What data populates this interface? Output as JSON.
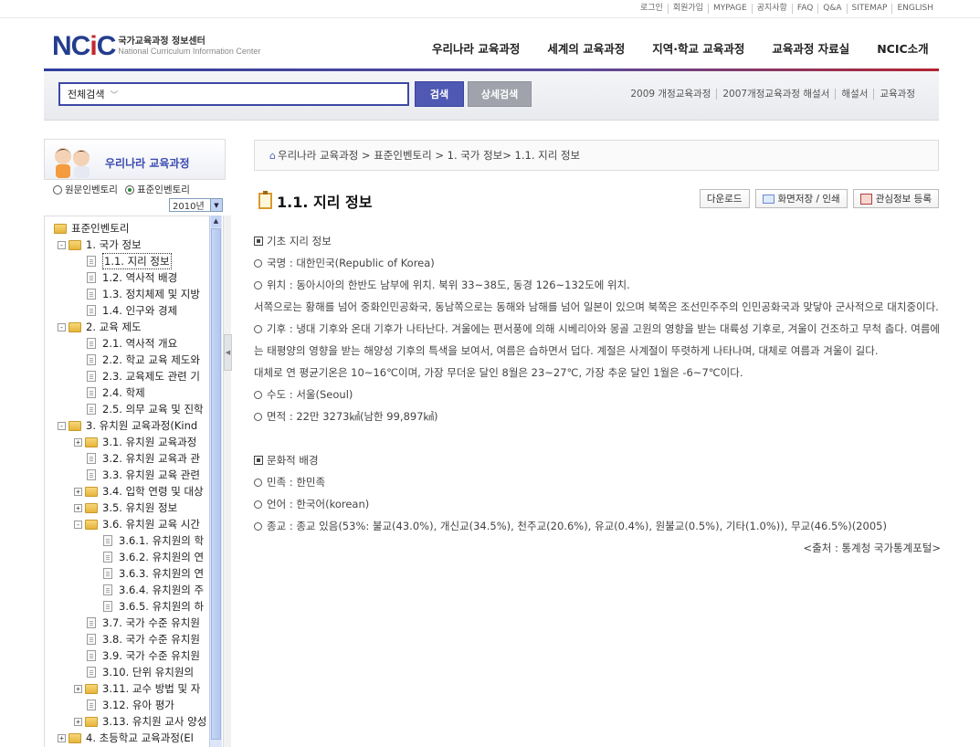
{
  "util_nav": [
    "로그인",
    "회원가입",
    "MYPAGE",
    "공지사항",
    "FAQ",
    "Q&A",
    "SITEMAP",
    "ENGLISH"
  ],
  "logo": {
    "mark_n": "N",
    "mark_c": "C",
    "mark_i": "i",
    "mark_c2": "C",
    "title_ko": "국가교육과정 정보센터",
    "title_en": "National Curriculum Information Center"
  },
  "gnb": [
    "우리나라 교육과정",
    "세계의 교육과정",
    "지역·학교 교육과정",
    "교육과정 자료실",
    "NCIC소개"
  ],
  "search": {
    "scope": "전체검색",
    "button": "검색",
    "advanced": "상세검색"
  },
  "quick_links": [
    "2009 개정교육과정",
    "2007개정교육과정 해설서",
    "해설서",
    "교육과정"
  ],
  "lnb": {
    "title": "우리나라 교육과정",
    "radio_original": "원문인벤토리",
    "radio_standard": "표준인벤토리",
    "year": "2010년"
  },
  "tree": [
    {
      "label": "표준인벤토리",
      "level": 0,
      "kind": "folder",
      "toggle": ""
    },
    {
      "label": "1. 국가 정보",
      "level": 1,
      "kind": "folder",
      "toggle": "-"
    },
    {
      "label": "1.1. 지리 정보",
      "level": 2,
      "kind": "doc",
      "toggle": "",
      "selected": true
    },
    {
      "label": "1.2. 역사적 배경",
      "level": 2,
      "kind": "doc",
      "toggle": ""
    },
    {
      "label": "1.3. 정치체제 및 지방",
      "level": 2,
      "kind": "doc",
      "toggle": ""
    },
    {
      "label": "1.4. 인구와 경제",
      "level": 2,
      "kind": "doc",
      "toggle": ""
    },
    {
      "label": "2. 교육 제도",
      "level": 1,
      "kind": "folder",
      "toggle": "-"
    },
    {
      "label": "2.1. 역사적 개요",
      "level": 2,
      "kind": "doc",
      "toggle": ""
    },
    {
      "label": "2.2. 학교 교육 제도와",
      "level": 2,
      "kind": "doc",
      "toggle": ""
    },
    {
      "label": "2.3. 교육제도 관련 기",
      "level": 2,
      "kind": "doc",
      "toggle": ""
    },
    {
      "label": "2.4. 학제",
      "level": 2,
      "kind": "doc",
      "toggle": ""
    },
    {
      "label": "2.5. 의무 교육 및 진학",
      "level": 2,
      "kind": "doc",
      "toggle": ""
    },
    {
      "label": "3. 유치원 교육과정(Kind",
      "level": 1,
      "kind": "folder",
      "toggle": "-"
    },
    {
      "label": "3.1. 유치원 교육과정",
      "level": 2,
      "kind": "folder",
      "toggle": "+"
    },
    {
      "label": "3.2. 유치원 교육과 관",
      "level": 2,
      "kind": "doc",
      "toggle": ""
    },
    {
      "label": "3.3. 유치원 교육 관련",
      "level": 2,
      "kind": "doc",
      "toggle": ""
    },
    {
      "label": "3.4. 입학 연령 및 대상",
      "level": 2,
      "kind": "folder",
      "toggle": "+"
    },
    {
      "label": "3.5. 유치원 정보",
      "level": 2,
      "kind": "folder",
      "toggle": "+"
    },
    {
      "label": "3.6. 유치원 교육 시간",
      "level": 2,
      "kind": "folder",
      "toggle": "-"
    },
    {
      "label": "3.6.1. 유치원의 학",
      "level": 3,
      "kind": "doc",
      "toggle": ""
    },
    {
      "label": "3.6.2. 유치원의 연",
      "level": 3,
      "kind": "doc",
      "toggle": ""
    },
    {
      "label": "3.6.3. 유치원의 연",
      "level": 3,
      "kind": "doc",
      "toggle": ""
    },
    {
      "label": "3.6.4. 유치원의 주",
      "level": 3,
      "kind": "doc",
      "toggle": ""
    },
    {
      "label": "3.6.5. 유치원의 하",
      "level": 3,
      "kind": "doc",
      "toggle": ""
    },
    {
      "label": "3.7. 국가 수준 유치원",
      "level": 2,
      "kind": "doc",
      "toggle": ""
    },
    {
      "label": "3.8. 국가 수준 유치원",
      "level": 2,
      "kind": "doc",
      "toggle": ""
    },
    {
      "label": "3.9. 국가 수준 유치원",
      "level": 2,
      "kind": "doc",
      "toggle": ""
    },
    {
      "label": "3.10. 단위 유치원의",
      "level": 2,
      "kind": "doc",
      "toggle": ""
    },
    {
      "label": "3.11. 교수 방법 및 자",
      "level": 2,
      "kind": "folder",
      "toggle": "+"
    },
    {
      "label": "3.12. 유아 평가",
      "level": 2,
      "kind": "doc",
      "toggle": ""
    },
    {
      "label": "3.13. 유치원 교사 양성",
      "level": 2,
      "kind": "folder",
      "toggle": "+"
    },
    {
      "label": "4. 초등학교 교육과정(El",
      "level": 1,
      "kind": "folder",
      "toggle": "+"
    }
  ],
  "breadcrumb": "우리나라 교육과정 > 표준인벤토리 > 1. 국가 정보> 1.1. 지리 정보",
  "page_title": "1.1. 지리 정보",
  "tools": {
    "download": "다운로드",
    "print": "화면저장 / 인쇄",
    "interest": "관심정보 등록"
  },
  "content": {
    "section1_title": "기초 지리 정보",
    "country": "국명 : 대한민국(Republic of Korea)",
    "location": "위치 : 동아시아의 한반도 남부에 위치. 북위 33~38도, 동경 126~132도에 위치.",
    "location_detail": "서쪽으로는 황해를 넘어 중화인민공화국, 동남쪽으로는 동해와 남해를 넘어 일본이 있으며 북쪽은 조선민주주의 인민공화국과 맞닿아 군사적으로 대치중이다.",
    "climate": "기후 : 냉대 기후와 온대 기후가 나타난다. 겨울에는 편서풍에 의해 시베리아와 몽골 고원의 영향을 받는 대륙성 기후로, 겨울이 건조하고 무척 춥다. 여름에는 태평양의 영향을 받는 해양성 기후의 특색을 보여서, 여름은 습하면서 덥다. 계절은 사계절이 뚜렷하게 나타나며, 대체로 여름과 겨울이 길다.",
    "climate_detail": "대체로 연 평균기온은 10~16℃이며, 가장 무더운 달인 8월은 23~27℃, 가장 추운 달인 1월은 -6~7℃이다.",
    "capital": "수도 : 서울(Seoul)",
    "area": "면적 : 22만 3273㎢(남한 99,897㎢)",
    "section2_title": "문화적 배경",
    "ethnicity": "민족 : 한민족",
    "language": "언어 : 한국어(korean)",
    "religion": "종교 : 종교 있음(53%: 불교(43.0%), 개신교(34.5%), 천주교(20.6%), 유교(0.4%), 원불교(0.5%), 기타(1.0%)), 무교(46.5%)(2005)",
    "source": "<출처 : 통계청 국가통계포털>"
  },
  "colors": {
    "brand_blue": "#243d8e",
    "brand_red": "#c0282e",
    "accent": "#4f58b3"
  }
}
